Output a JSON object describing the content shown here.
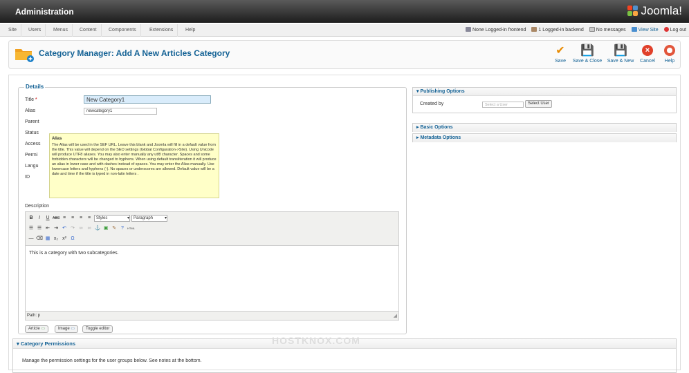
{
  "header": {
    "title": "Administration",
    "logo_text": "Joomla!"
  },
  "menu": [
    {
      "label": "Site"
    },
    {
      "label": "Users"
    },
    {
      "label": "Menus"
    },
    {
      "label": "Content"
    },
    {
      "label": "Components"
    },
    {
      "label": "Extensions"
    },
    {
      "label": "Help"
    }
  ],
  "status": {
    "frontend": "None Logged-in frontend",
    "backend": "1 Logged-in backend",
    "messages": "No messages",
    "view_site": "View Site",
    "logout": "Log out"
  },
  "toolbar": {
    "title": "Category Manager: Add A New Articles Category",
    "buttons": {
      "save": "Save",
      "save_close": "Save & Close",
      "save_new": "Save & New",
      "cancel": "Cancel",
      "help": "Help"
    }
  },
  "details": {
    "legend": "Details",
    "labels": {
      "title": "Title",
      "required": "*",
      "alias": "Alias",
      "parent": "Parent",
      "status": "Status",
      "access": "Access",
      "permissions": "Permi",
      "language": "Langu",
      "id": "ID"
    },
    "title_value": "New Category1",
    "alias_value": "newcategory1"
  },
  "tooltip": {
    "heading": "Alias",
    "body": "The Alias will be used in the SEF URL. Leave this blank and Joomla will fill in a default value from the title. This value will depend on the SEO settings (Global Configuration->Site). Using Unicode will produce UTF8 aliases. You may also enter manually any utf8 character. Spaces and some forbidden characters will be changed to hyphens. When using default transliteration it will produce an alias in lower case and with dashes instead of spaces. You may enter the Alias manually. Use lowercase letters and hyphens (-). No spaces or underscores are allowed. Default value will be a date and time if the title is typed in non-latin letters ."
  },
  "editor": {
    "label": "Description",
    "styles": "Styles",
    "format": "Paragraph",
    "content": "This is a category with two subcategories.",
    "path": "Path: p",
    "buttons": {
      "article": "Article",
      "image": "Image",
      "toggle": "Toggle editor"
    }
  },
  "panels": {
    "publishing": "Publishing Options",
    "created_by_label": "Created by",
    "select_user_placeholder": "Select a User",
    "select_user_button": "Select User",
    "basic": "Basic Options",
    "metadata": "Metadata Options"
  },
  "permissions": {
    "title": "Category Permissions",
    "text": "Manage the permission settings for the user groups below. See notes at the bottom."
  },
  "watermark": "HOSTKNOX.COM"
}
